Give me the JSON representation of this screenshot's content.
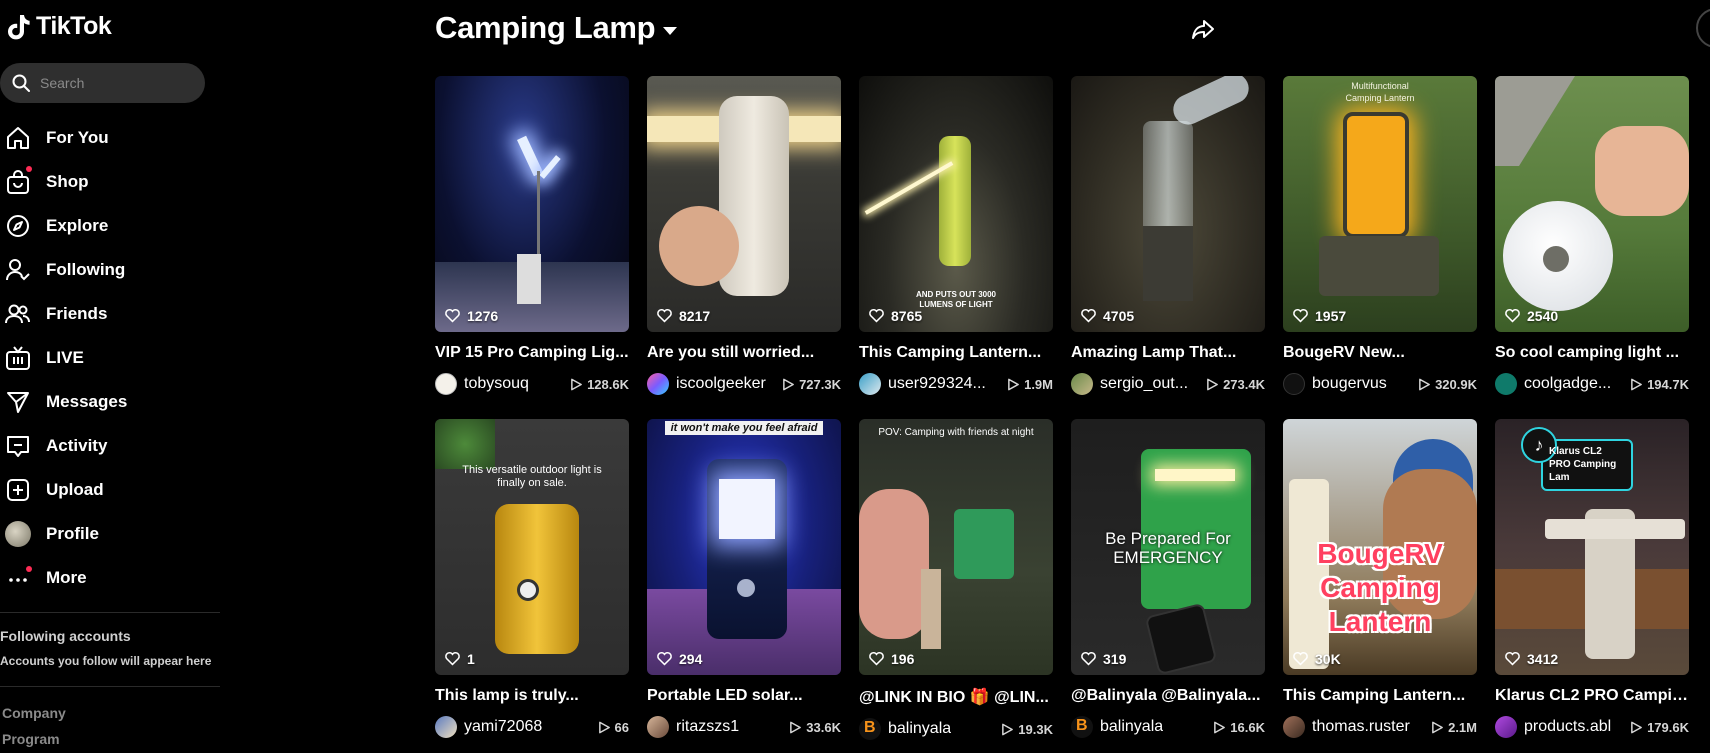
{
  "sidebar": {
    "logo_text": "TikTok",
    "search_placeholder": "Search",
    "nav": [
      {
        "label": "For You",
        "icon": "home-icon"
      },
      {
        "label": "Shop",
        "icon": "shop-bag-icon"
      },
      {
        "label": "Explore",
        "icon": "compass-icon"
      },
      {
        "label": "Following",
        "icon": "person-follow-icon"
      },
      {
        "label": "Friends",
        "icon": "friends-icon"
      },
      {
        "label": "LIVE",
        "icon": "live-tv-icon"
      },
      {
        "label": "Messages",
        "icon": "paper-plane-icon"
      },
      {
        "label": "Activity",
        "icon": "activity-bubble-icon"
      },
      {
        "label": "Upload",
        "icon": "plus-square-icon"
      },
      {
        "label": "Profile",
        "icon": "avatar"
      },
      {
        "label": "More",
        "icon": "more-dots-icon"
      }
    ],
    "following_heading": "Following accounts",
    "following_sub": "Accounts you follow will appear here",
    "footer_links": [
      "Company",
      "Program"
    ]
  },
  "header": {
    "title": "Camping Lamp"
  },
  "colors": {
    "accent": "#fe2c55",
    "background": "#000000",
    "search_bg": "#2f2f2f"
  },
  "videos": [
    {
      "caption": "VIP 15 Pro Camping Lig...",
      "user": "tobysouq",
      "views": "128.6K",
      "likes": "1276",
      "overlay": ""
    },
    {
      "caption": "Are you still worried...",
      "user": "iscoolgeeker",
      "views": "727.3K",
      "likes": "8217",
      "overlay": ""
    },
    {
      "caption": "This Camping Lantern...",
      "user": "user929324...",
      "views": "1.9M",
      "likes": "8765",
      "overlay": "AND PUTS OUT 3000 LUMENS OF LIGHT"
    },
    {
      "caption": "Amazing Lamp That...",
      "user": "sergio_out...",
      "views": "273.4K",
      "likes": "4705",
      "overlay": ""
    },
    {
      "caption": "BougeRV New...",
      "user": "bougervus",
      "views": "320.9K",
      "likes": "1957",
      "overlay": "Multifunctional Camping Lantern"
    },
    {
      "caption": "So cool camping light ...",
      "user": "coolgadge...",
      "views": "194.7K",
      "likes": "2540",
      "overlay": ""
    },
    {
      "caption": "This lamp is truly...",
      "user": "yami72068",
      "views": "66",
      "likes": "1",
      "overlay": "This versatile outdoor light is finally on sale."
    },
    {
      "caption": "Portable LED solar...",
      "user": "ritazszs1",
      "views": "33.6K",
      "likes": "294",
      "overlay": "it won't make you feel afraid"
    },
    {
      "caption": "@LINK IN BIO 🎁 @LIN...",
      "user": "balinyala",
      "views": "19.3K",
      "likes": "196",
      "overlay": "POV: Camping with friends at night"
    },
    {
      "caption": "@Balinyala @Balinyala...",
      "user": "balinyala",
      "views": "16.6K",
      "likes": "319",
      "overlay": "Be Prepared For EMERGENCY"
    },
    {
      "caption": "This Camping Lantern...",
      "user": "thomas.ruster",
      "views": "2.1M",
      "likes": "30K",
      "overlay": "BougeRV Camping Lantern"
    },
    {
      "caption": "Klarus CL2 PRO Campin...",
      "user": "products.abl",
      "views": "179.6K",
      "likes": "3412",
      "overlay": "Klarus CL2 PRO Camping Lam"
    }
  ]
}
